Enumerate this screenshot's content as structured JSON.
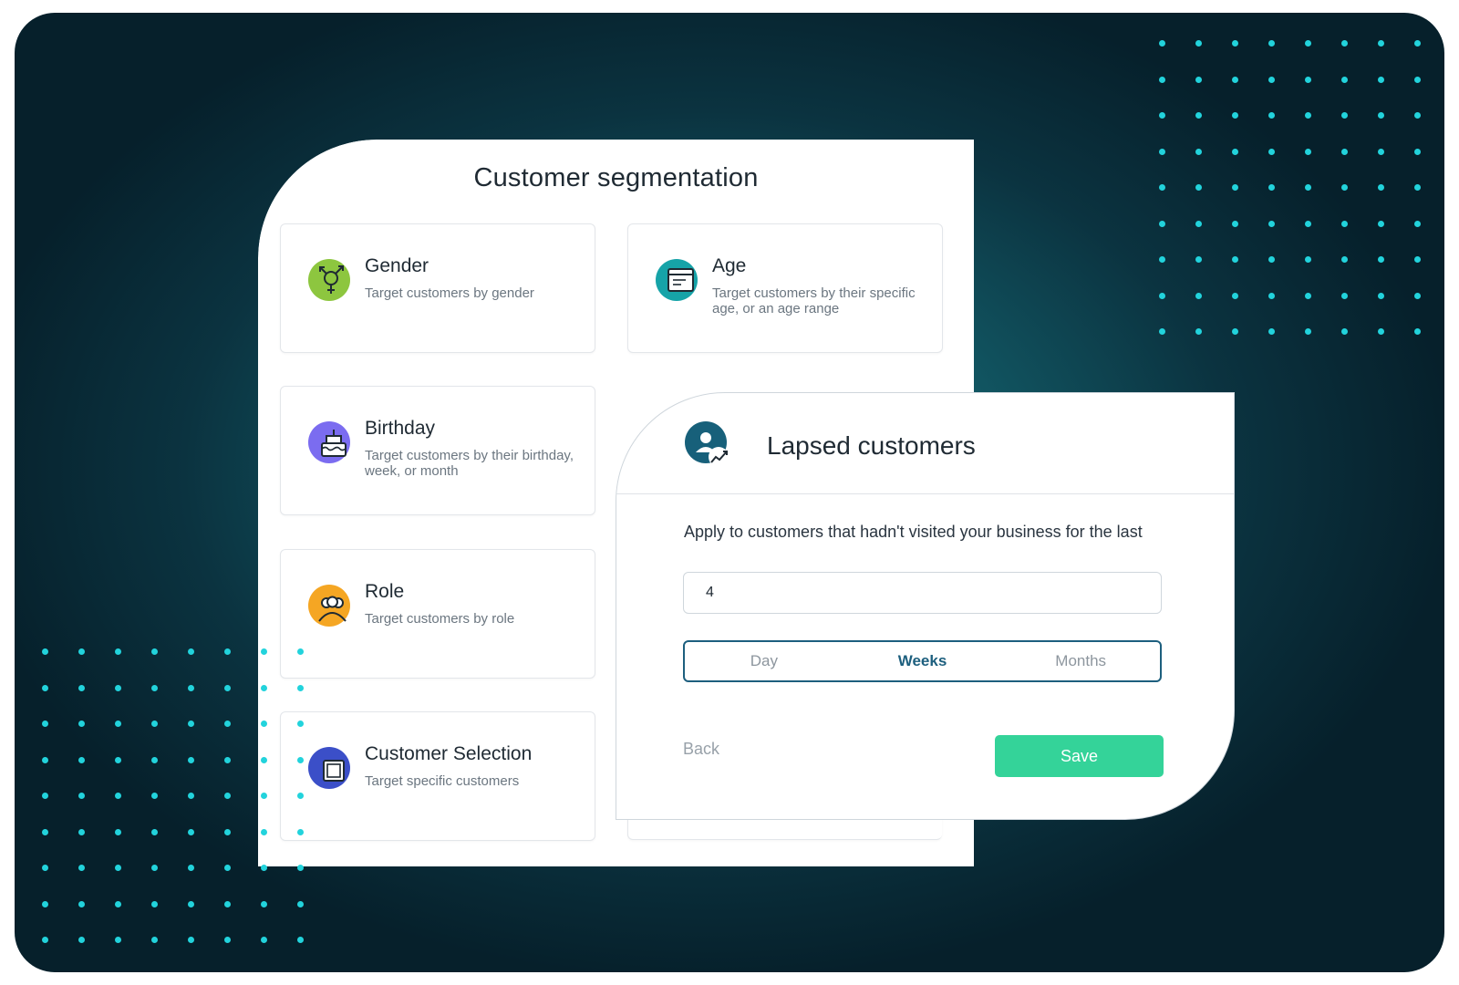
{
  "segmentation": {
    "title": "Customer segmentation",
    "options": [
      {
        "name": "Gender",
        "desc": "Target customers by gender",
        "icon": "gender-icon",
        "color": "#8dc63f"
      },
      {
        "name": "Age",
        "desc": "Target customers by their specific age, or an age range",
        "icon": "calendar-icon",
        "color": "#16a3a8"
      },
      {
        "name": "Birthday",
        "desc": "Target customers by their birthday, week, or month",
        "icon": "cake-icon",
        "color": "#7b6cf0"
      },
      {
        "name": "Role",
        "desc": "Target customers by role",
        "icon": "people-icon",
        "color": "#f5a623"
      },
      {
        "name": "Customer Selection",
        "desc": "Target specific customers",
        "icon": "selection-icon",
        "color": "#3b4fc8"
      }
    ]
  },
  "lapsed": {
    "title": "Lapsed customers",
    "icon": "user-trend-icon",
    "instruction": "Apply to customers that hadn't visited your business for the last",
    "value": "4",
    "periods": [
      "Day",
      "Weeks",
      "Months"
    ],
    "selected_period": "Weeks",
    "back_label": "Back",
    "save_label": "Save"
  },
  "colors": {
    "accent": "#1d5f7e",
    "save": "#34d399",
    "dots": "#22d3dc"
  }
}
